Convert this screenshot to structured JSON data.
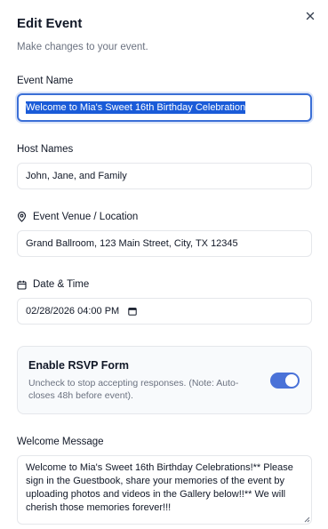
{
  "dialog": {
    "title": "Edit Event",
    "subtitle": "Make changes to your event."
  },
  "fields": {
    "event_name": {
      "label": "Event Name",
      "value": "Welcome to Mia's Sweet 16th Birthday Celebration"
    },
    "host_names": {
      "label": "Host Names",
      "value": "John, Jane, and Family"
    },
    "venue": {
      "label": "Event Venue / Location",
      "icon": "location-pin-icon",
      "value": "Grand Ballroom, 123 Main Street, City, TX 12345"
    },
    "datetime": {
      "label": "Date & Time",
      "icon": "calendar-icon",
      "value": "02/28/2026 04:00 PM"
    }
  },
  "rsvp": {
    "title": "Enable RSVP Form",
    "description": "Uncheck to stop accepting responses. (Note: Auto-closes 48h before event).",
    "enabled": true
  },
  "welcome": {
    "label": "Welcome Message",
    "value": "Welcome to Mia's Sweet 16th Birthday Celebrations!** Please sign in the Guestbook, share your memories of the event by uploading photos and videos in the Gallery below!!** We will cherish those memories forever!!!"
  },
  "colors": {
    "accent": "#4a72d8",
    "selection": "#1a5bd8",
    "focus_ring": "#3b6fd6"
  }
}
